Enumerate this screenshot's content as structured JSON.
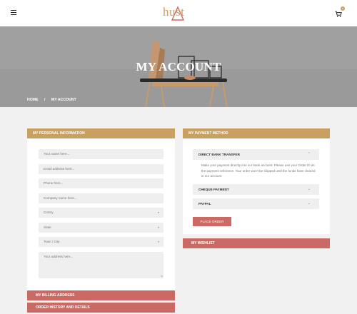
{
  "header": {
    "logo_text": "hust",
    "cart_count": "0"
  },
  "hero": {
    "title": "MY ACCOUNT",
    "breadcrumb": {
      "home": "HOME",
      "separator": "/",
      "current": "MY ACCOUNT"
    }
  },
  "personal_info": {
    "heading": "MY PERSONAL INFORMATION",
    "fields": {
      "name_placeholder": "Your name here...",
      "email_placeholder": "Email address here...",
      "phone_placeholder": "Phone here...",
      "company_placeholder": "Company name here...",
      "country": "Contry",
      "state": "State",
      "town": "Town / City",
      "address_placeholder": "Your address here..."
    }
  },
  "payment": {
    "heading": "MY PAYMENT METHOD",
    "methods": [
      {
        "label": "DIRECT BANK TRANSFER",
        "expanded": true,
        "description": "Make your payment directly into our bank account. Please use your Order ID as the payment reference. Your order won't be shipped until the funds have cleared in our account."
      },
      {
        "label": "CHEQUE PAYMENT",
        "expanded": false
      },
      {
        "label": "PAYPAL",
        "expanded": false
      }
    ],
    "place_order_label": "PLACE ORDER"
  },
  "wishlist": {
    "heading": "MY WISHLIST"
  },
  "billing": {
    "heading": "MY BILLING ADDRESS"
  },
  "order_history": {
    "heading": "ORDER HISTORY AND DETAILS"
  },
  "colors": {
    "gold": "#c9a060",
    "rose": "#cb6a64",
    "logo": "#c9a06a"
  },
  "icons": {
    "menu": "hamburger-menu-icon",
    "cart": "shopping-cart-icon",
    "chevron_up": "chevron-up-icon",
    "chevron_down": "chevron-down-icon"
  }
}
